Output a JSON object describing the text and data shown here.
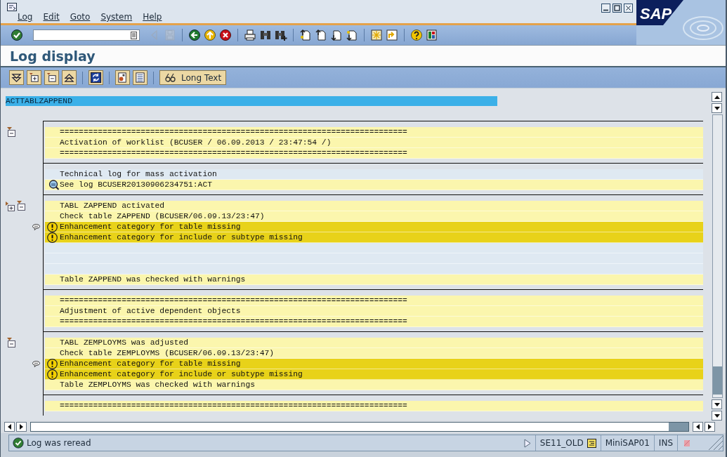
{
  "menu": [
    "Log",
    "Edit",
    "Goto",
    "System",
    "Help"
  ],
  "logo": "SAP",
  "system_toolbar": [
    {
      "buttons": [
        {
          "kind": "enter",
          "disabled": false
        }
      ]
    },
    {
      "buttons": [
        {
          "kind": "nav-back",
          "disabled": true
        },
        {
          "kind": "save",
          "disabled": true
        }
      ]
    },
    {
      "buttons": [
        {
          "kind": "back",
          "disabled": false
        },
        {
          "kind": "exit",
          "disabled": false
        },
        {
          "kind": "cancel",
          "disabled": false
        }
      ]
    },
    {
      "buttons": [
        {
          "kind": "print",
          "disabled": false
        },
        {
          "kind": "find",
          "disabled": false
        },
        {
          "kind": "find-next",
          "disabled": false
        }
      ]
    },
    {
      "buttons": [
        {
          "kind": "first-page",
          "disabled": false
        },
        {
          "kind": "prev-page",
          "disabled": false
        },
        {
          "kind": "next-page",
          "disabled": false
        },
        {
          "kind": "last-page",
          "disabled": false
        }
      ]
    },
    {
      "buttons": [
        {
          "kind": "new-session",
          "disabled": false
        },
        {
          "kind": "shortcut",
          "disabled": false
        }
      ]
    },
    {
      "buttons": [
        {
          "kind": "help",
          "disabled": false
        },
        {
          "kind": "layout",
          "disabled": false
        }
      ]
    }
  ],
  "title": "Log display",
  "app_toolbar": [
    {
      "buttons": [
        {
          "kind": "expand-all"
        },
        {
          "kind": "expand"
        },
        {
          "kind": "collapse"
        },
        {
          "kind": "collapse-all"
        }
      ]
    },
    {
      "buttons": [
        {
          "kind": "refresh"
        }
      ]
    },
    {
      "buttons": [
        {
          "kind": "detail"
        },
        {
          "kind": "list"
        }
      ]
    },
    {
      "buttons": [
        {
          "kind": "long-text",
          "label": "Long Text"
        }
      ]
    }
  ],
  "log_header": "ACTTABLZAPPEND",
  "blocks": [
    {
      "collapsible": true,
      "expandable": false,
      "rows": [
        {
          "kind": "plain",
          "long_text": false,
          "text": "========================================================================="
        },
        {
          "kind": "plain",
          "long_text": false,
          "text": "Activation of worklist (BCUSER / 06.09.2013 / 23:47:54 /)"
        },
        {
          "kind": "plain",
          "long_text": false,
          "text": "========================================================================="
        }
      ]
    },
    {
      "collapsible": false,
      "expandable": false,
      "rows": [
        {
          "kind": "note",
          "long_text": false,
          "text": "Technical log for mass activation"
        },
        {
          "kind": "link",
          "long_text": false,
          "text": "See log BCUSER20130906234751:ACT"
        }
      ]
    },
    {
      "collapsible": true,
      "expandable": true,
      "rows": [
        {
          "kind": "plain",
          "long_text": false,
          "text": "TABL ZAPPEND activated"
        },
        {
          "kind": "plain",
          "long_text": false,
          "text": "Check table ZAPPEND (BCUSER/06.09.13/23:47)"
        },
        {
          "kind": "warning",
          "long_text": true,
          "text": "Enhancement category for table missing"
        },
        {
          "kind": "warning",
          "long_text": false,
          "text": "Enhancement category for include or subtype missing"
        },
        {
          "kind": "note",
          "long_text": false
        },
        {
          "kind": "note",
          "long_text": false
        },
        {
          "kind": "note",
          "long_text": false
        },
        {
          "kind": "plain",
          "long_text": false,
          "text": "Table ZAPPEND was checked with warnings"
        }
      ]
    },
    {
      "collapsible": false,
      "expandable": false,
      "rows": [
        {
          "kind": "plain",
          "long_text": false,
          "text": "========================================================================="
        },
        {
          "kind": "plain",
          "long_text": false,
          "text": "Adjustment of active dependent objects"
        },
        {
          "kind": "plain",
          "long_text": false,
          "text": "========================================================================="
        }
      ]
    },
    {
      "collapsible": true,
      "expandable": false,
      "rows": [
        {
          "kind": "plain",
          "long_text": false,
          "text": "TABL ZEMPLOYMS was adjusted"
        },
        {
          "kind": "plain",
          "long_text": false,
          "text": "Check table ZEMPLOYMS (BCUSER/06.09.13/23:47)"
        },
        {
          "kind": "warning",
          "long_text": true,
          "text": "Enhancement category for table missing"
        },
        {
          "kind": "warning",
          "long_text": false,
          "text": "Enhancement category for include or subtype missing"
        },
        {
          "kind": "plain",
          "long_text": false,
          "text": "Table ZEMPLOYMS was checked with warnings"
        }
      ]
    },
    {
      "collapsible": false,
      "expandable": false,
      "rows": [
        {
          "kind": "plain",
          "long_text": false,
          "text": "========================================================================="
        }
      ]
    }
  ],
  "status_bar": {
    "message": {
      "kind": "success",
      "text": "Log was reread"
    },
    "transaction": "SE11_OLD",
    "system": "MiniSAP01",
    "mode": "INS"
  }
}
